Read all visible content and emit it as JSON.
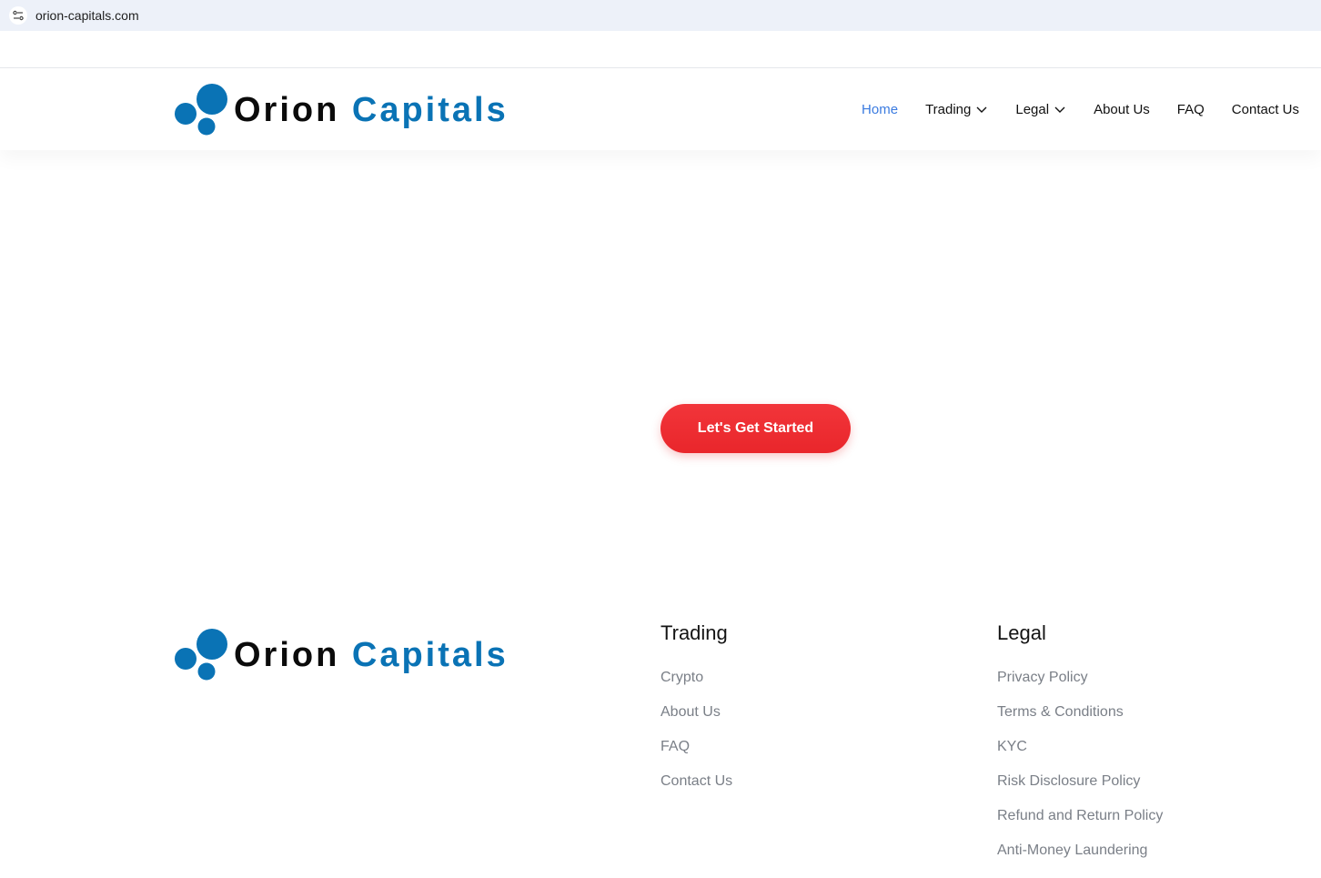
{
  "browser": {
    "url": "orion-capitals.com",
    "site_info_icon": "tune-icon"
  },
  "brand": {
    "word1": "Orion",
    "word2": "Capitals",
    "colors": {
      "dark": "#0b0b0b",
      "blue": "#0a73b5"
    }
  },
  "nav": {
    "items": [
      {
        "label": "Home",
        "active": true,
        "dropdown": false
      },
      {
        "label": "Trading",
        "active": false,
        "dropdown": true
      },
      {
        "label": "Legal",
        "active": false,
        "dropdown": true
      },
      {
        "label": "About Us",
        "active": false,
        "dropdown": false
      },
      {
        "label": "FAQ",
        "active": false,
        "dropdown": false
      },
      {
        "label": "Contact Us",
        "active": false,
        "dropdown": false
      }
    ],
    "active_color": "#3b7be0"
  },
  "hero": {
    "cta_label": "Let's Get Started",
    "cta_color": "#ee2e33"
  },
  "footer": {
    "trading": {
      "heading": "Trading",
      "links": [
        "Crypto",
        "About Us",
        "FAQ",
        "Contact Us"
      ]
    },
    "legal": {
      "heading": "Legal",
      "links": [
        "Privacy Policy",
        "Terms & Conditions",
        "KYC",
        "Risk Disclosure Policy",
        "Refund and Return Policy",
        "Anti-Money Laundering"
      ]
    }
  }
}
